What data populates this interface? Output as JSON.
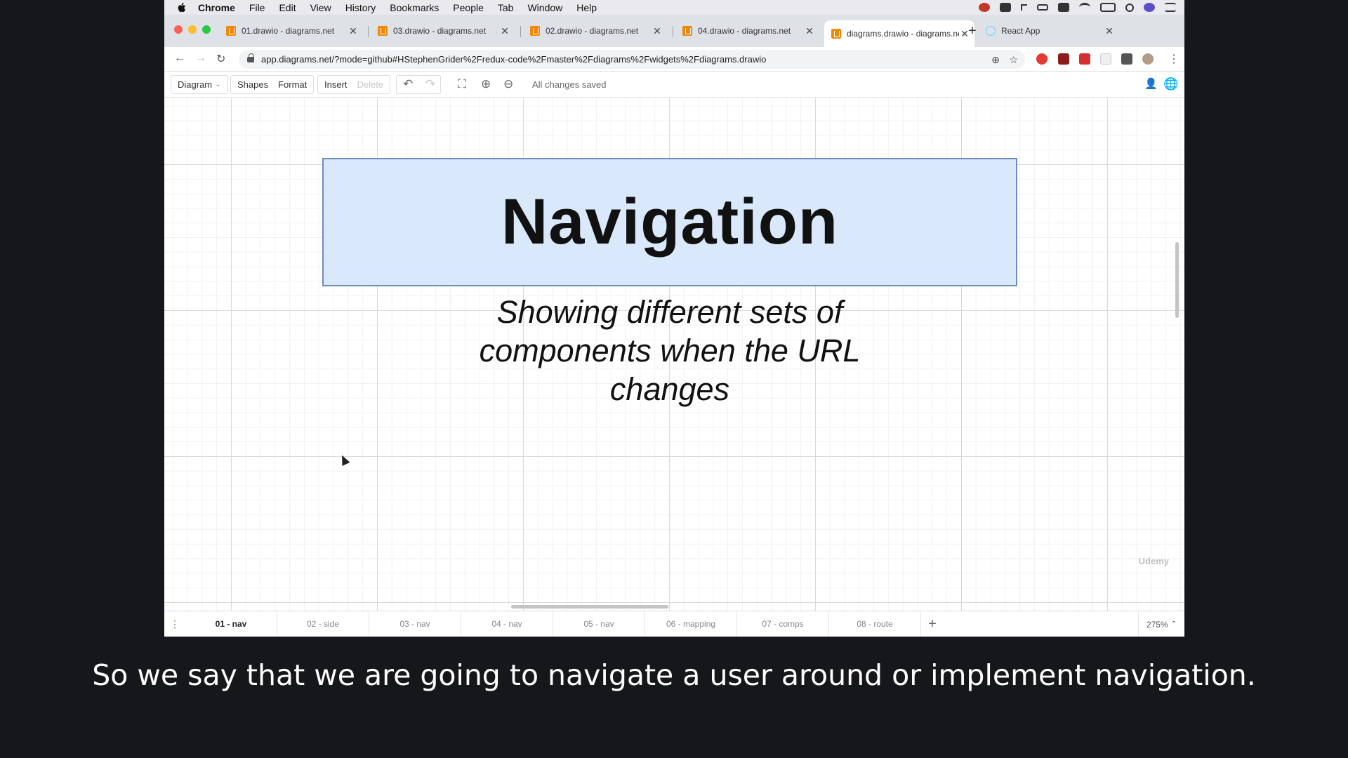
{
  "menubar": {
    "app": "Chrome",
    "items": [
      "File",
      "Edit",
      "View",
      "History",
      "Bookmarks",
      "People",
      "Tab",
      "Window",
      "Help"
    ]
  },
  "tabs": [
    {
      "title": "01.drawio - diagrams.net",
      "icon": "drawio-icon",
      "active": false
    },
    {
      "title": "03.drawio - diagrams.net",
      "icon": "drawio-icon",
      "active": false
    },
    {
      "title": "02.drawio - diagrams.net",
      "icon": "drawio-icon",
      "active": false
    },
    {
      "title": "04.drawio - diagrams.net",
      "icon": "drawio-icon",
      "active": false
    },
    {
      "title": "diagrams.drawio - diagrams.net",
      "icon": "drawio-icon",
      "active": true
    },
    {
      "title": "React App",
      "icon": "react-icon",
      "active": false
    }
  ],
  "address": {
    "url": "app.diagrams.net/?mode=github#HStephenGrider%2Fredux-code%2Fmaster%2Fdiagrams%2Fwidgets%2Fdiagrams.drawio"
  },
  "toolbar": {
    "diagram": "Diagram",
    "shapes": "Shapes",
    "format": "Format",
    "insert": "Insert",
    "delete": "Delete",
    "status": "All changes saved"
  },
  "canvas": {
    "box_title": "Navigation",
    "subtitle": "Showing different sets of components when the URL changes",
    "watermark": "Udemy"
  },
  "pages": [
    "01 - nav",
    "02 - side",
    "03 - nav",
    "04 - nav",
    "05 - nav",
    "06 - mapping",
    "07 - comps",
    "08 - route"
  ],
  "active_page": "01 - nav",
  "zoom": "275%",
  "caption": "So we say that we are going to navigate a user around or implement navigation.",
  "colors": {
    "box_fill": "#dae8fc",
    "box_stroke": "#6c8ebf",
    "drawio_orange": "#f08705"
  }
}
